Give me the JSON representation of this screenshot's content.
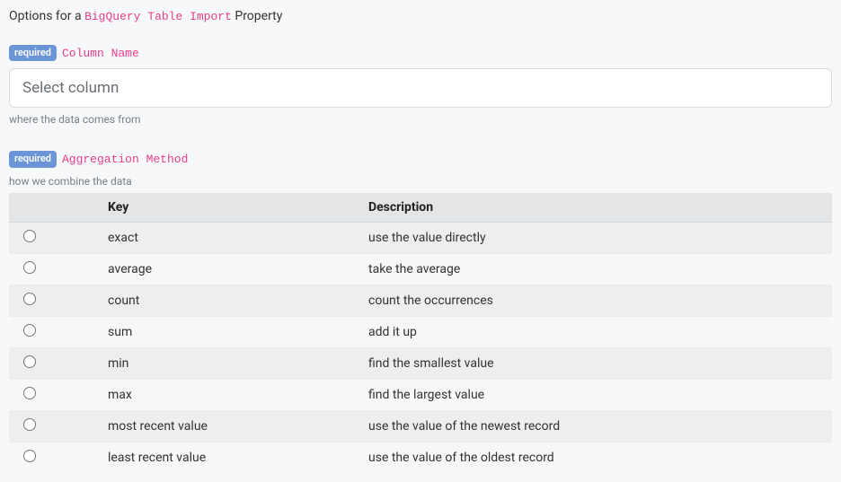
{
  "header": {
    "prefix": "Options for a ",
    "source_name": "BigQuery Table Import",
    "suffix": " Property"
  },
  "badges": {
    "required": "required"
  },
  "column_field": {
    "label": "Column Name",
    "placeholder": "Select column",
    "help": "where the data comes from"
  },
  "aggregation_field": {
    "label": "Aggregation Method",
    "help": "how we combine the data",
    "columns": {
      "radio": "",
      "key": "Key",
      "description": "Description"
    },
    "rows": [
      {
        "key": "exact",
        "description": "use the value directly"
      },
      {
        "key": "average",
        "description": "take the average"
      },
      {
        "key": "count",
        "description": "count the occurrences"
      },
      {
        "key": "sum",
        "description": "add it up"
      },
      {
        "key": "min",
        "description": "find the smallest value"
      },
      {
        "key": "max",
        "description": "find the largest value"
      },
      {
        "key": "most recent value",
        "description": "use the value of the newest record"
      },
      {
        "key": "least recent value",
        "description": "use the value of the oldest record"
      }
    ]
  }
}
